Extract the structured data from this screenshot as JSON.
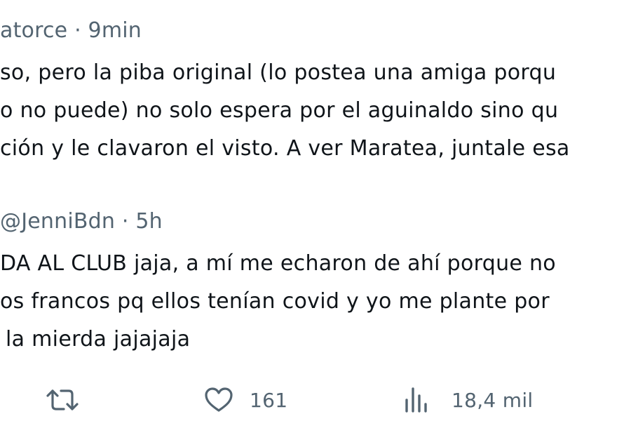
{
  "tweet1": {
    "meta": "atorce · 9min",
    "lines": [
      "so, pero la piba original (lo postea una amiga porqu",
      "o no puede) no solo espera por el aguinaldo sino qu",
      "ción y le clavaron el visto. A ver Maratea, juntale esa"
    ]
  },
  "tweet2": {
    "meta": "@JenniBdn · 5h",
    "lines": [
      "DA AL CLUB jaja, a mí me echaron de ahí porque no",
      "os francos pq ellos tenían covid y yo me plante por",
      "la mierda jajajaja"
    ]
  },
  "actions": {
    "retweet_icon": "retweet-icon",
    "like_icon": "heart-icon",
    "like_count": "161",
    "views_icon": "views-chart-icon",
    "views_count": "18,4 mil"
  },
  "colors": {
    "text": "#0f1419",
    "secondary": "#536471",
    "background": "#ffffff"
  }
}
